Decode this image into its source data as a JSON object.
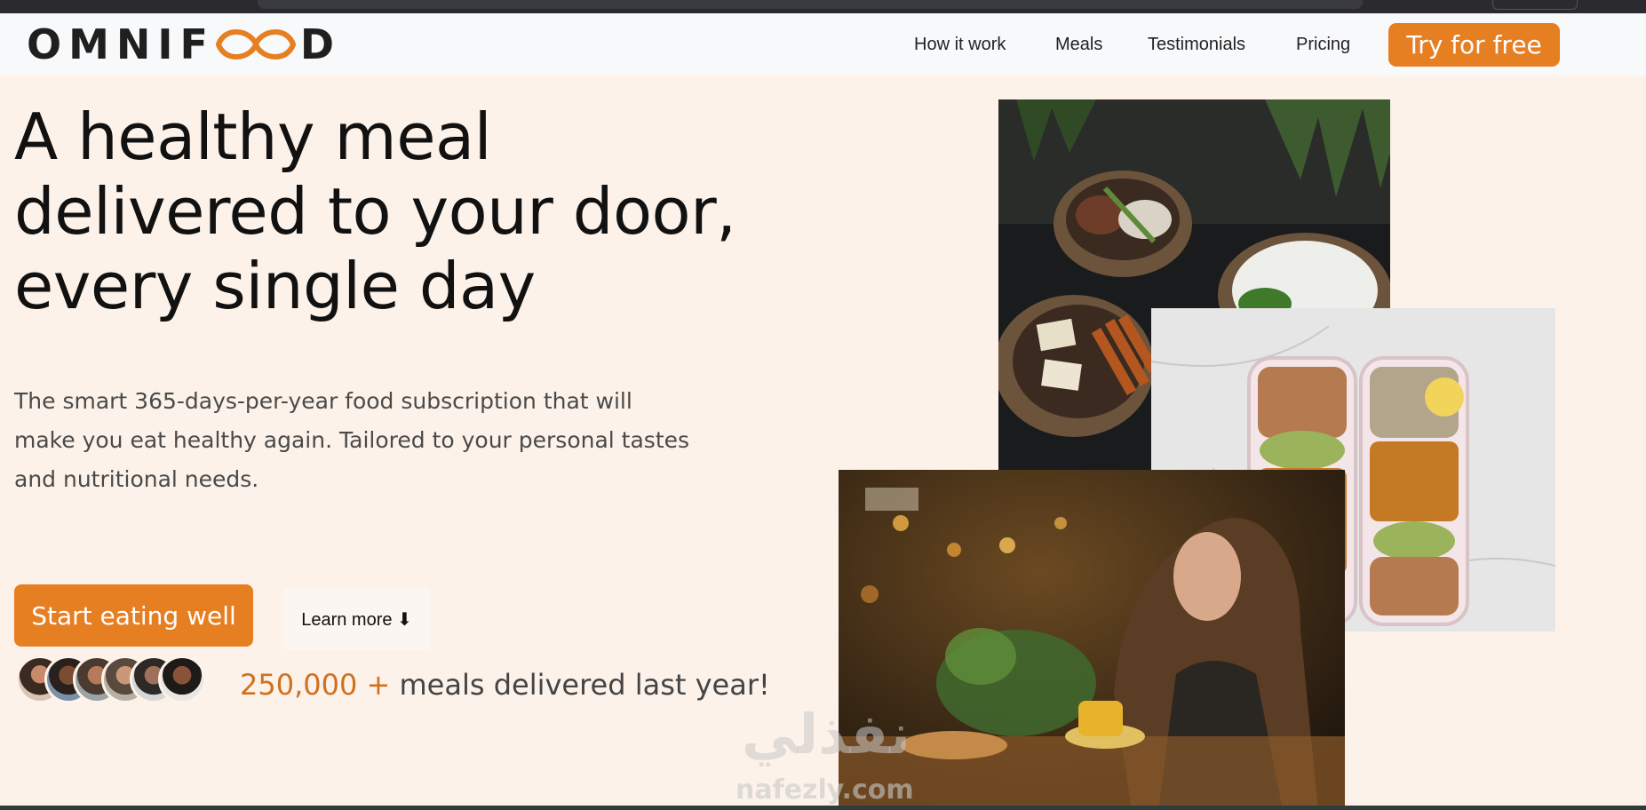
{
  "nav": {
    "logo_text_left": "OMNIF",
    "logo_text_right": "D",
    "links": [
      "How it work",
      "Meals",
      "Testimonials",
      "Pricing"
    ],
    "cta": "Try for free"
  },
  "hero": {
    "title_line1": "A healthy meal",
    "title_line2": "delivered to your door,",
    "title_line3": "every single day",
    "description_line1": "The smart 365-days-per-year food subscription that will",
    "description_line2": "make you eat healthy again. Tailored to your personal tastes",
    "description_line3": "and nutritional needs.",
    "primary_button": "Start eating well",
    "secondary_button": "Learn more ⬇",
    "delivered_number": "250,000 +",
    "delivered_text": " meals delivered last year!"
  },
  "watermark": {
    "arabic": "نفذلي",
    "latin": "nafezly.com"
  },
  "colors": {
    "accent": "#e67e22",
    "background": "#fdf2e9",
    "nav_bg": "#f8f9fb",
    "number": "#cf711f"
  },
  "icons": {
    "logo_mark": "infinity-icon",
    "learn_more_arrow": "arrow-down-icon"
  }
}
